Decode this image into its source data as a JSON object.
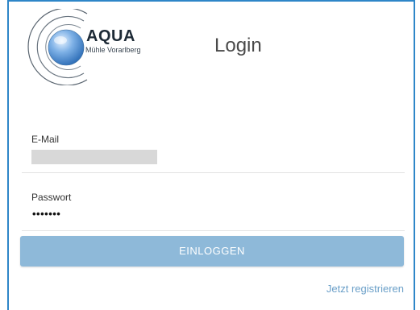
{
  "logo": {
    "title": "AQUA",
    "subtitle": "Mühle Vorarlberg"
  },
  "page": {
    "title": "Login"
  },
  "form": {
    "email_label": "E-Mail",
    "password_label": "Passwort",
    "password_value": "•••••••",
    "submit_label": "EINLOGGEN",
    "register_link": "Jetzt registrieren"
  },
  "colors": {
    "frame_border": "#2e86c8",
    "button_bg": "#8eb9d9",
    "link": "#6a9fc8"
  }
}
